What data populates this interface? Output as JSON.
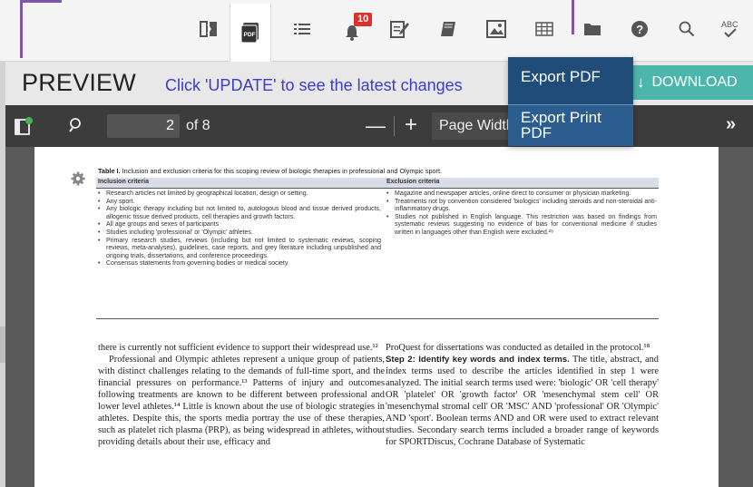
{
  "toolbar": {
    "notification_count": "10",
    "spellcheck_label": "ABC"
  },
  "preview": {
    "title": "PREVIEW",
    "hint": "Click 'UPDATE' to see the latest changes",
    "download_label": "DOWNLOAD",
    "download_icon": "↓"
  },
  "dropdown": {
    "items": [
      {
        "label": "Export PDF"
      },
      {
        "label": "Export Print PDF"
      }
    ]
  },
  "pdf_viewer": {
    "current_page": "2",
    "page_of": "of 8",
    "zoom_minus": "—",
    "zoom_plus": "+",
    "zoom_value": "Page Width",
    "next_icon": "»"
  },
  "document": {
    "table_caption_bold": "Table I.",
    "table_caption": " Inclusion and exclusion criteria for this scoping review of biologic therapies in professional and Olympic sport.",
    "inclusion_header": "Inclusion criteria",
    "exclusion_header": "Exclusion criteria",
    "inclusion": [
      "Research articles not limited by geographical location, design or setting.",
      "Any sport.",
      "Any biologic therapy including but not limited to, autologous blood and tissue derived products, allogenic tissue derived products, cell therapies and growth factors.",
      "All age groups and sexes of participants",
      "Studies including 'professional' or 'Olympic' athletes.",
      "Primary research studies, reviews (including but not limited to systematic reviews, scoping reviews, meta-analyses), guidelines, case reports, and grey literature including unpublished and ongoing trials, dissertations, and conference proceedings.",
      "Consensus statements from governing bodies or medical society."
    ],
    "exclusion": [
      "Magazine and newspaper articles, online direct to consumer or physician marketing.",
      "Treatments not by convention considered 'biologics' including steroids and non-steroidal anti-inflammatory drugs.",
      "Studies not published in English language. This restriction was based on findings from systematic reviews suggesting no evidence of bias for conventional medicine if studies written in languages other than English were excluded.²⁸"
    ],
    "left_column": {
      "p1": "there is currently not sufficient evidence to support their widespread use.¹²",
      "p2": "Professional and Olympic athletes represent a unique group of patients, with distinct challenges relating to the demands of full-time sport, and the financial pressures on performance.¹³ Patterns of injury and outcomes following treatments are known to be different between professional and lower level athletes.¹⁴ Little is known about the use of biologic strategies in athletes. Despite this, the sports media portray the use of these therapies, such as platelet rich plasma (PRP), as being widespread in athletes, without providing details about their use, efficacy and"
    },
    "right_column": {
      "p1": "ProQuest for dissertations was conducted as detailed in the protocol.¹⁸",
      "step_label": "Step 2: Identify key words and index terms.",
      "p2": " The title, abstract, and index terms used to describe the articles identified in step 1 were analyzed. The initial search terms used were: 'biologic' OR 'cell therapy' OR 'platelet' OR 'growth factor' OR 'mesenchymal stem cell' OR 'mesenchymal stromal cell' OR 'MSC' AND 'professional' OR 'Olympic' AND 'sport'. Boolean terms AND and OR were used to extract relevant studies. Secondary search terms included a broader range of keywords for SPORTDiscus, Cochrane Database of Systematic"
    }
  }
}
